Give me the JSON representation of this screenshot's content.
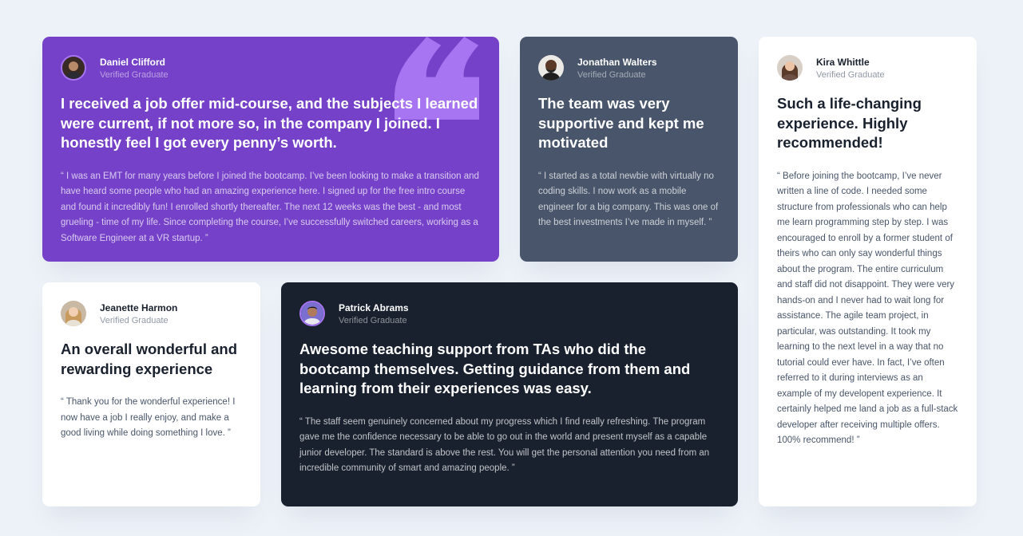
{
  "testimonials": [
    {
      "name": "Daniel Clifford",
      "role": "Verified Graduate",
      "headline": "I received a job offer mid-course, and the subjects I learned were current, if not more so, in the company I joined. I honestly feel I got every penny’s worth.",
      "body": "“ I was an EMT for many years before I joined the bootcamp. I’ve been looking to make a transition and have heard some people who had an amazing experience here. I signed up for the free intro course and found it incredibly fun! I enrolled shortly thereafter. The next 12 weeks was the best - and most grueling - time of my life. Since completing the course, I’ve successfully switched careers, working as a Software Engineer at a VR startup. ”",
      "card_color": "#7541c8"
    },
    {
      "name": "Jonathan Walters",
      "role": "Verified Graduate",
      "headline": "The team was very supportive and kept me motivated",
      "body": "“ I started as a total newbie with virtually no coding skills. I now work as a mobile engineer for a big company. This was one of the best investments I’ve made in myself. ”",
      "card_color": "#48556a"
    },
    {
      "name": "Jeanette Harmon",
      "role": "Verified Graduate",
      "headline": "An overall wonderful and rewarding experience",
      "body": "“ Thank you for the wonderful experience! I now have a job I really enjoy, and make a good living while doing something I love. ”",
      "card_color": "#ffffff"
    },
    {
      "name": "Patrick Abrams",
      "role": "Verified Graduate",
      "headline": "Awesome teaching support from TAs who did the bootcamp themselves. Getting guidance from them and learning from their experiences was easy.",
      "body": "“ The staff seem genuinely concerned about my progress which I find really refreshing. The program gave me the confidence necessary to be able to go out in the world and present myself as a capable junior developer. The standard is above the rest. You will get the personal attention you need from an incredible community of smart and amazing people. ”",
      "card_color": "#19212e"
    },
    {
      "name": "Kira Whittle",
      "role": "Verified Graduate",
      "headline": "Such a life-changing experience. Highly recommended!",
      "body": "“ Before joining the bootcamp, I’ve never written a line of code. I needed some structure from professionals who can help me learn programming step by step. I was encouraged to enroll by a former student of theirs who can only say wonderful things about the program. The entire curriculum and staff did not disappoint. They were very hands-on and I never had to wait long for assistance. The agile team project, in particular, was outstanding. It took my learning to the next level in a way that no tutorial could ever have. In fact, I’ve often referred to it during interviews as an example of my developent experience. It certainly helped me land a job as a full-stack developer after receiving multiple offers. 100% recommend! ”",
      "card_color": "#ffffff"
    }
  ],
  "icons": {
    "quote": "quote-icon",
    "avatar": "avatar-photo"
  },
  "colors": {
    "background": "#edf2f8",
    "accent_violet": "#a775f1"
  }
}
